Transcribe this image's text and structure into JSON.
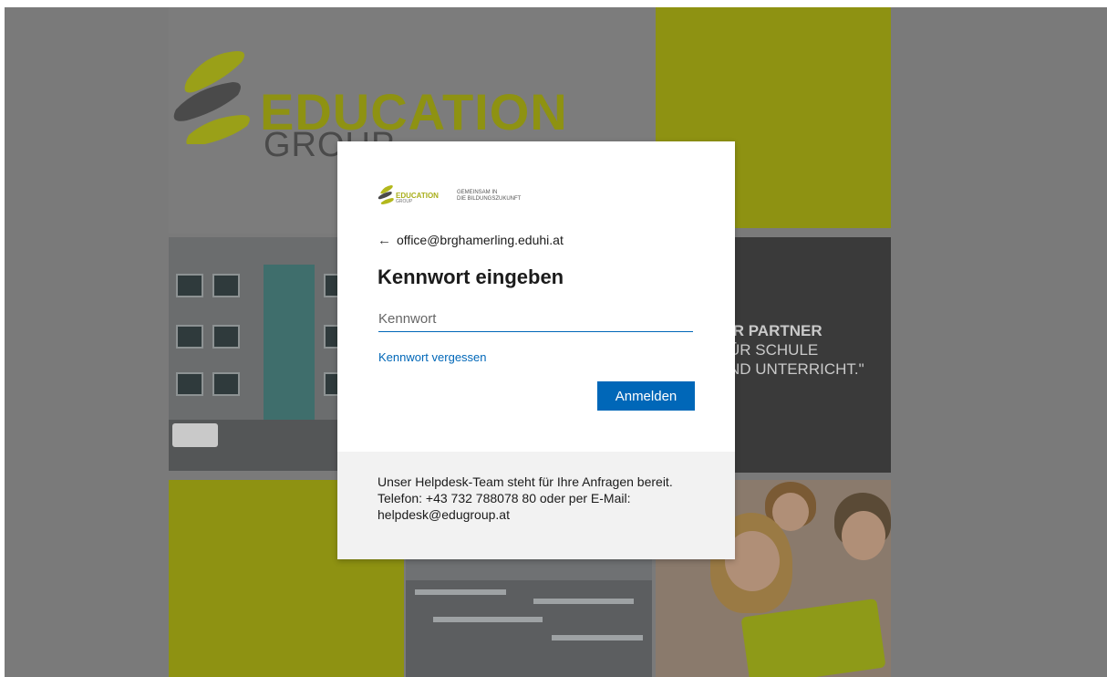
{
  "background": {
    "logo_text": "EDUCATION",
    "logo_sub": "GROUP",
    "slogan_lines": [
      "IR PARTNER",
      "ÜR  SCHULE",
      "ND UNTERRICHT.\""
    ],
    "colors": {
      "accent_green": "#8e9212",
      "dark_panel": "#3a3a3a"
    }
  },
  "dialog": {
    "logo_text": "EDUCATION",
    "logo_sub": "GROUP",
    "tagline_1": "GEMEINSAM IN",
    "tagline_2": "DIE BILDUNGSZUKUNFT",
    "back_icon": "arrow-left-icon",
    "identity": "office@brghamerling.eduhi.at",
    "title": "Kennwort eingeben",
    "password": {
      "value": "",
      "placeholder": "Kennwort"
    },
    "forgot_link": "Kennwort vergessen",
    "submit_label": "Anmelden",
    "footer_text": "Unser Helpdesk-Team steht für Ihre Anfragen bereit. Telefon: +43 732 788078 80 oder per E-Mail: helpdesk@edugroup.at",
    "colors": {
      "primary": "#0067b8",
      "footer_bg": "#f2f2f2"
    }
  }
}
